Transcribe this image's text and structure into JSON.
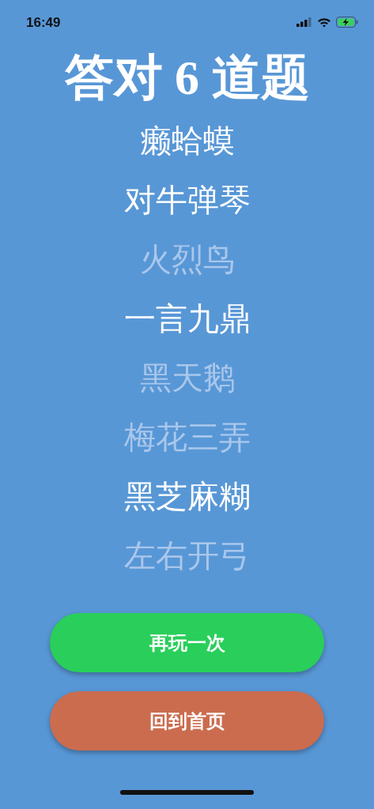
{
  "status_bar": {
    "time": "16:49",
    "charging": true
  },
  "title": "答对 6 道题",
  "answers": [
    {
      "text": "癞蛤蟆",
      "correct": true
    },
    {
      "text": "对牛弹琴",
      "correct": true
    },
    {
      "text": "火烈鸟",
      "correct": false
    },
    {
      "text": "一言九鼎",
      "correct": true
    },
    {
      "text": "黑天鹅",
      "correct": false
    },
    {
      "text": "梅花三弄",
      "correct": false
    },
    {
      "text": "黑芝麻糊",
      "correct": true
    },
    {
      "text": "左右开弓",
      "correct": false
    }
  ],
  "buttons": [
    {
      "label": "再玩一次",
      "color": "#29cf5a"
    },
    {
      "label": "回到首页",
      "color": "#cb6c4f"
    }
  ]
}
